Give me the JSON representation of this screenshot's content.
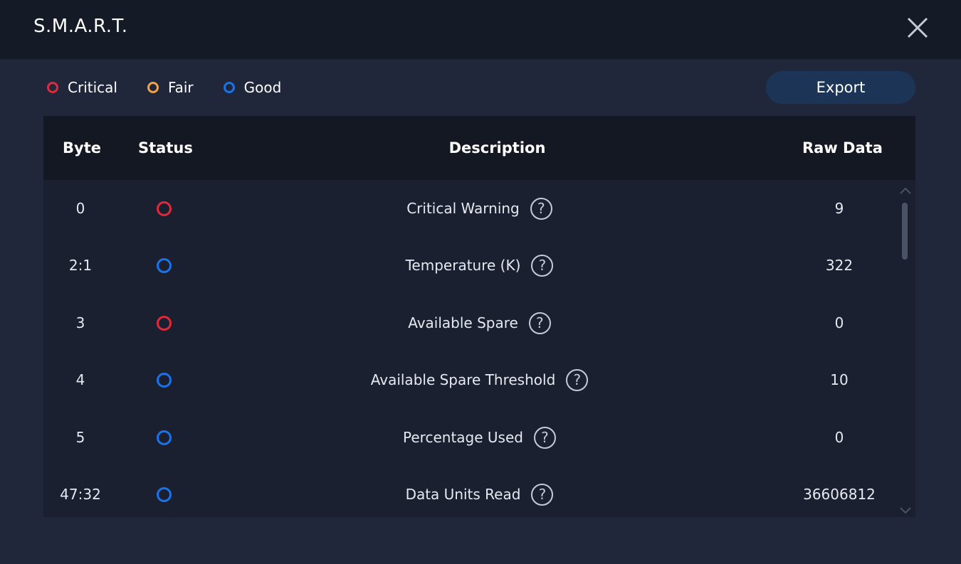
{
  "window": {
    "title": "S.M.A.R.T."
  },
  "legend": [
    {
      "label": "Critical",
      "color": "#e02a3c"
    },
    {
      "label": "Fair",
      "color": "#f0a24a"
    },
    {
      "label": "Good",
      "color": "#1a73e8"
    }
  ],
  "toolbar": {
    "export_label": "Export"
  },
  "table": {
    "headers": {
      "byte": "Byte",
      "status": "Status",
      "description": "Description",
      "raw": "Raw Data"
    },
    "rows": [
      {
        "byte": "0",
        "status": "critical",
        "description": "Critical Warning",
        "raw": "9"
      },
      {
        "byte": "2:1",
        "status": "good",
        "description": "Temperature (K)",
        "raw": "322"
      },
      {
        "byte": "3",
        "status": "critical",
        "description": "Available Spare",
        "raw": "0"
      },
      {
        "byte": "4",
        "status": "good",
        "description": "Available Spare Threshold",
        "raw": "10"
      },
      {
        "byte": "5",
        "status": "good",
        "description": "Percentage Used",
        "raw": "0"
      },
      {
        "byte": "47:32",
        "status": "good",
        "description": "Data Units Read",
        "raw": "36606812"
      }
    ],
    "help_glyph": "?"
  },
  "icons": {
    "close": "close-icon",
    "help": "question-circle-icon",
    "scroll_up": "chevron-up-icon",
    "scroll_down": "chevron-down-icon"
  }
}
